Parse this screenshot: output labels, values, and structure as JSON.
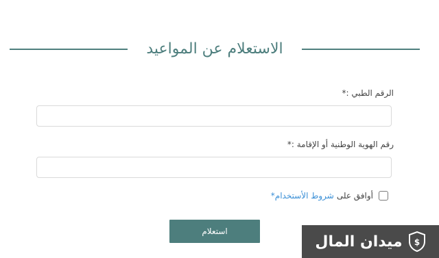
{
  "page": {
    "title": "الاستعلام عن المواعيد"
  },
  "form": {
    "medical_number": {
      "label": "الرقم الطبي :*",
      "value": "",
      "placeholder": ""
    },
    "national_id": {
      "label": "رقم الهوية الوطنية أو الإقامة :*",
      "value": "",
      "placeholder": ""
    },
    "agree": {
      "checked": false,
      "text": "أوافق على",
      "link_text": "شروط الأستخدام*"
    },
    "submit_label": "استعلام"
  },
  "watermark": {
    "text": "ميدان المال",
    "icon": "money-shield-icon"
  },
  "colors": {
    "accent": "#4d7e7d",
    "link": "#3a8fd6",
    "watermark_bg": "#4a4a4a"
  }
}
